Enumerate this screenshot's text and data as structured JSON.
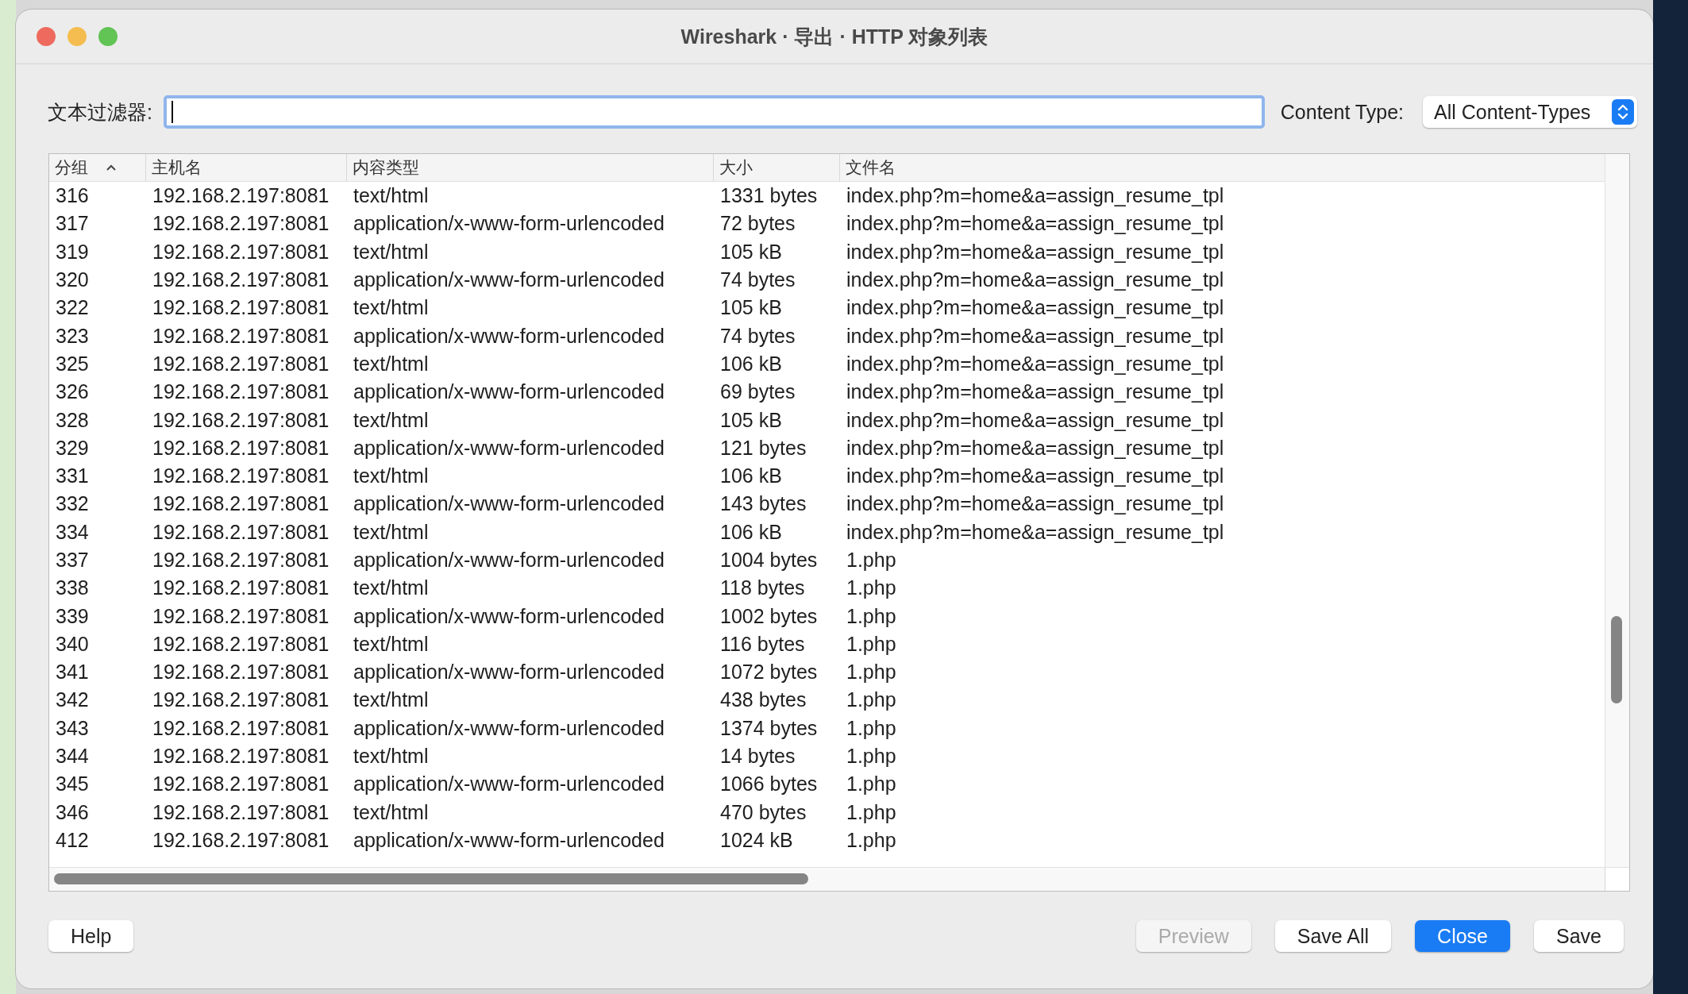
{
  "window": {
    "title": "Wireshark · 导出 · HTTP 对象列表"
  },
  "filter": {
    "label": "文本过滤器:"
  },
  "content_type": {
    "label": "Content Type:",
    "value": "All Content-Types"
  },
  "table": {
    "columns": [
      "分组",
      "主机名",
      "内容类型",
      "大小",
      "文件名"
    ],
    "rows": [
      [
        "316",
        "192.168.2.197:8081",
        "text/html",
        "1331 bytes",
        "index.php?m=home&a=assign_resume_tpl"
      ],
      [
        "317",
        "192.168.2.197:8081",
        "application/x-www-form-urlencoded",
        "72 bytes",
        "index.php?m=home&a=assign_resume_tpl"
      ],
      [
        "319",
        "192.168.2.197:8081",
        "text/html",
        "105 kB",
        "index.php?m=home&a=assign_resume_tpl"
      ],
      [
        "320",
        "192.168.2.197:8081",
        "application/x-www-form-urlencoded",
        "74 bytes",
        "index.php?m=home&a=assign_resume_tpl"
      ],
      [
        "322",
        "192.168.2.197:8081",
        "text/html",
        "105 kB",
        "index.php?m=home&a=assign_resume_tpl"
      ],
      [
        "323",
        "192.168.2.197:8081",
        "application/x-www-form-urlencoded",
        "74 bytes",
        "index.php?m=home&a=assign_resume_tpl"
      ],
      [
        "325",
        "192.168.2.197:8081",
        "text/html",
        "106 kB",
        "index.php?m=home&a=assign_resume_tpl"
      ],
      [
        "326",
        "192.168.2.197:8081",
        "application/x-www-form-urlencoded",
        "69 bytes",
        "index.php?m=home&a=assign_resume_tpl"
      ],
      [
        "328",
        "192.168.2.197:8081",
        "text/html",
        "105 kB",
        "index.php?m=home&a=assign_resume_tpl"
      ],
      [
        "329",
        "192.168.2.197:8081",
        "application/x-www-form-urlencoded",
        "121 bytes",
        "index.php?m=home&a=assign_resume_tpl"
      ],
      [
        "331",
        "192.168.2.197:8081",
        "text/html",
        "106 kB",
        "index.php?m=home&a=assign_resume_tpl"
      ],
      [
        "332",
        "192.168.2.197:8081",
        "application/x-www-form-urlencoded",
        "143 bytes",
        "index.php?m=home&a=assign_resume_tpl"
      ],
      [
        "334",
        "192.168.2.197:8081",
        "text/html",
        "106 kB",
        "index.php?m=home&a=assign_resume_tpl"
      ],
      [
        "337",
        "192.168.2.197:8081",
        "application/x-www-form-urlencoded",
        "1004 bytes",
        "1.php"
      ],
      [
        "338",
        "192.168.2.197:8081",
        "text/html",
        "118 bytes",
        "1.php"
      ],
      [
        "339",
        "192.168.2.197:8081",
        "application/x-www-form-urlencoded",
        "1002 bytes",
        "1.php"
      ],
      [
        "340",
        "192.168.2.197:8081",
        "text/html",
        "116 bytes",
        "1.php"
      ],
      [
        "341",
        "192.168.2.197:8081",
        "application/x-www-form-urlencoded",
        "1072 bytes",
        "1.php"
      ],
      [
        "342",
        "192.168.2.197:8081",
        "text/html",
        "438 bytes",
        "1.php"
      ],
      [
        "343",
        "192.168.2.197:8081",
        "application/x-www-form-urlencoded",
        "1374 bytes",
        "1.php"
      ],
      [
        "344",
        "192.168.2.197:8081",
        "text/html",
        "14 bytes",
        "1.php"
      ],
      [
        "345",
        "192.168.2.197:8081",
        "application/x-www-form-urlencoded",
        "1066 bytes",
        "1.php"
      ],
      [
        "346",
        "192.168.2.197:8081",
        "text/html",
        "470 bytes",
        "1.php"
      ],
      [
        "412",
        "192.168.2.197:8081",
        "application/x-www-form-urlencoded",
        "1024 kB",
        "1.php"
      ]
    ]
  },
  "buttons": [
    {
      "label": "Help",
      "disabled": false,
      "primary": false
    },
    {
      "label": "Preview",
      "disabled": true,
      "primary": false
    },
    {
      "label": "Save All",
      "disabled": false,
      "primary": false
    },
    {
      "label": "Close",
      "disabled": false,
      "primary": true
    },
    {
      "label": "Save",
      "disabled": false,
      "primary": false
    }
  ]
}
